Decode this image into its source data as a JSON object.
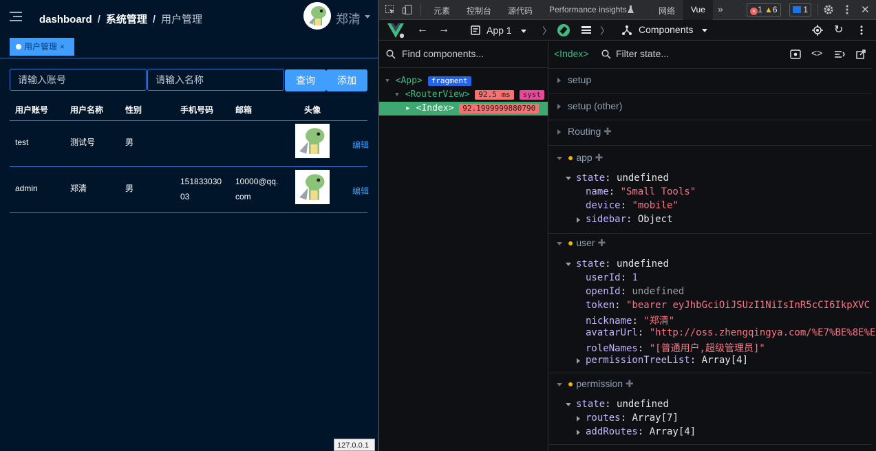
{
  "app": {
    "breadcrumb": [
      "dashboard",
      "系统管理",
      "用户管理"
    ],
    "separator": "/",
    "user_name": "郑清",
    "tag": {
      "label": "用户管理",
      "close": "×"
    },
    "search": {
      "account_placeholder": "请输入账号",
      "name_placeholder": "请输入名称",
      "query": "查询",
      "add": "添加"
    },
    "table": {
      "headers": [
        "用户账号",
        "用户名称",
        "性别",
        "手机号码",
        "邮箱",
        "头像"
      ],
      "rows": [
        {
          "account": "test",
          "name": "测试号",
          "gender": "男",
          "phone1": "",
          "phone2": "",
          "email1": "",
          "email2": "",
          "action": "编辑"
        },
        {
          "account": "admin",
          "name": "郑清",
          "gender": "男",
          "phone1": "151833030",
          "phone2": "03",
          "email1": "10000@qq.",
          "email2": "com",
          "action": "编辑"
        }
      ]
    },
    "status_url": "127.0.0.1"
  },
  "devtools": {
    "tabs": [
      "元素",
      "控制台",
      "源代码",
      "Performance insights",
      "网络",
      "Vue"
    ],
    "errors": "1",
    "warnings": "6",
    "messages": "1",
    "vue": {
      "app_label": "App 1",
      "components_label": "Components",
      "find_placeholder": "Find components...",
      "selected": "<Index>",
      "filter_placeholder": "Filter state...",
      "tree": {
        "app": "App",
        "fragment": "fragment",
        "routerview": "RouterView",
        "routerview_time": "92.5 ms",
        "routerview_badge": "syst",
        "index": "Index",
        "index_time": "92.1999999880790"
      },
      "sections": {
        "setup": "setup",
        "setup_other": "setup (other)",
        "routing": "Routing",
        "app": "app",
        "user": "user",
        "permission": "permission"
      },
      "app_state": {
        "state": "state",
        "state_val": "undefined",
        "name_k": "name",
        "name_v": "\"Small Tools\"",
        "device_k": "device",
        "device_v": "\"mobile\"",
        "sidebar_k": "sidebar",
        "sidebar_v": "Object"
      },
      "user_state": {
        "state": "state",
        "state_val": "undefined",
        "userId_k": "userId",
        "userId_v": "1",
        "openId_k": "openId",
        "openId_v": "undefined",
        "token_k": "token",
        "token_v": "\"bearer eyJhbGciOiJSUzI1NiIsInR5cCI6IkpXVC",
        "nickname_k": "nickname",
        "nickname_v": "\"郑清\"",
        "avatarUrl_k": "avatarUrl",
        "avatarUrl_v": "\"http://oss.zhengqingya.com/%E7%BE%8E%E",
        "roleNames_k": "roleNames",
        "roleNames_v": "\"[普通用户,超级管理员]\"",
        "ptl_k": "permissionTreeList",
        "ptl_v": "Array[4]"
      },
      "perm_state": {
        "state": "state",
        "state_val": "undefined",
        "routes_k": "routes",
        "routes_v": "Array[7]",
        "addRoutes_k": "addRoutes",
        "addRoutes_v": "Array[4]"
      }
    }
  }
}
